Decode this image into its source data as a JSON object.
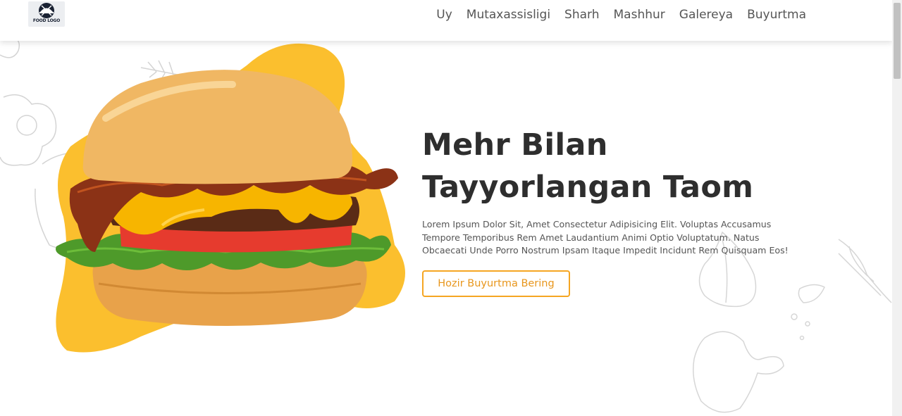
{
  "header": {
    "logo_text": "FOOD LOGO",
    "nav": [
      {
        "label": "Uy"
      },
      {
        "label": "Mutaxassisligi"
      },
      {
        "label": "Sharh"
      },
      {
        "label": "Mashhur"
      },
      {
        "label": "Galereya"
      },
      {
        "label": "Buyurtma"
      }
    ]
  },
  "hero": {
    "title": "Mehr Bilan Tayyorlangan Taom",
    "description": "Lorem Ipsum Dolor Sit, Amet Consectetur Adipisicing Elit. Voluptas Accusamus Tempore Temporibus Rem Amet Laudantium Animi Optio Voluptatum. Natus Obcaecati Unde Porro Nostrum Ipsam Itaque Impedit Incidunt Rem Quisquam Eos!",
    "cta_label": "Hozir Buyurtma Bering"
  },
  "colors": {
    "accent": "#f5a623",
    "blob": "#fbbf2e",
    "title": "#2e2e2e"
  },
  "icons": [
    "food-logo-icon",
    "burger-image",
    "vegetable-sketch-decoration"
  ]
}
